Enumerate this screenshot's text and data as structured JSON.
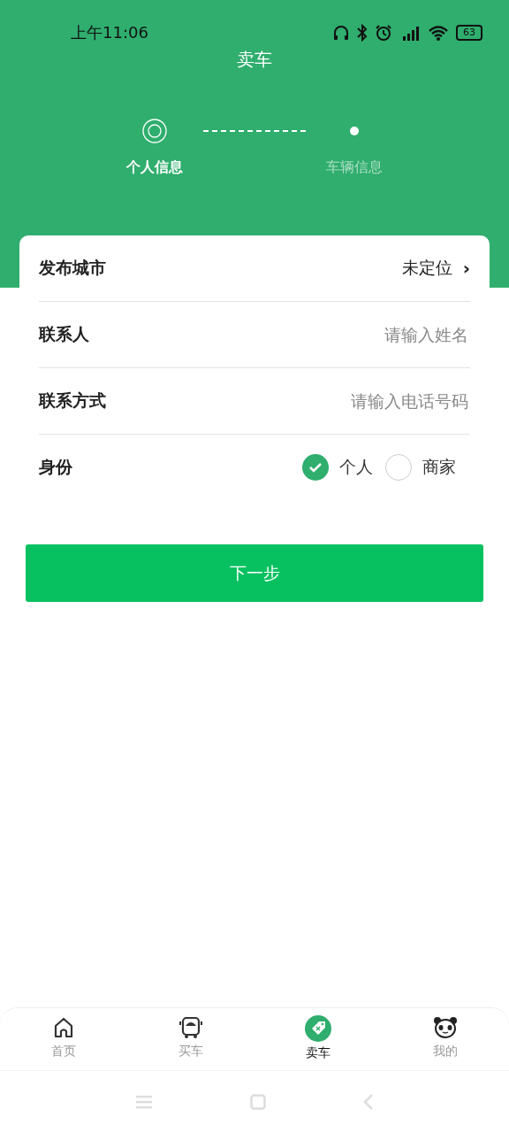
{
  "status_bar": {
    "time": "上午11:06",
    "battery": "63"
  },
  "header": {
    "title": "卖车"
  },
  "steps": [
    {
      "label": "个人信息",
      "selected": true
    },
    {
      "label": "车辆信息",
      "selected": false
    }
  ],
  "form": {
    "rows": [
      {
        "kind": "select",
        "label": "发布城市",
        "value": "未定位",
        "chevron": "›"
      },
      {
        "kind": "input",
        "label": "联系人",
        "placeholder": "请输入姓名"
      },
      {
        "kind": "input",
        "label": "联系方式",
        "placeholder": "请输入电话号码"
      },
      {
        "kind": "radio",
        "label": "身份",
        "options": [
          {
            "label": "个人",
            "selected": true
          },
          {
            "label": "商家",
            "selected": false
          }
        ]
      }
    ]
  },
  "next_button": "下一步",
  "tab_bar": [
    {
      "label": "首页",
      "kind": "home",
      "selected": false
    },
    {
      "label": "买车",
      "kind": "bus",
      "selected": false
    },
    {
      "label": "卖车",
      "kind": "tag",
      "selected": true
    },
    {
      "label": "我的",
      "kind": "panda",
      "selected": false
    }
  ]
}
